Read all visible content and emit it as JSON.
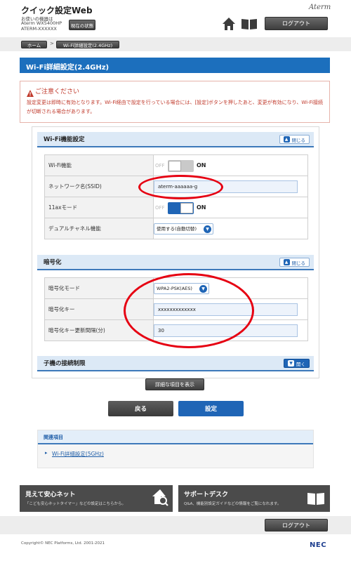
{
  "header": {
    "title": "クイック設定Web",
    "device_label": "お使いの機器は",
    "device_model": "Aterm WX5400HP",
    "device_ssid": "ATERM-XXXXXX",
    "status_button": "現在の状態",
    "logo": "Aterm",
    "logout_button": "ログアウト"
  },
  "breadcrumb": {
    "home": "ホーム",
    "separator": ">",
    "current": "Wi-Fi詳細設定(2.4GHz)"
  },
  "page_title": "Wi-Fi詳細設定(2.4GHz)",
  "notice": {
    "heading": "ご注意ください",
    "text": "設定変更は即時に有効となります。Wi-Fi経由で設定を行っている場合には、[設定]ボタンを押したあと、変更が有効になり、Wi-Fi接続が切断される場合があります。"
  },
  "wifi_section": {
    "title": "Wi-Fi機能設定",
    "toggle": "閉じる",
    "rows": {
      "wifi_label": "Wi-Fi機能",
      "wifi_off": "OFF",
      "wifi_on": "ON",
      "ssid_label": "ネットワーク名(SSID)",
      "ssid_value": "aterm-aaaaaa-g",
      "ax_label": "11axモード",
      "ax_off": "OFF",
      "ax_on": "ON",
      "dual_label": "デュアルチャネル機能",
      "dual_value": "使用する(自動切替)"
    }
  },
  "enc_section": {
    "title": "暗号化",
    "toggle": "閉じる",
    "rows": {
      "mode_label": "暗号化モード",
      "mode_value": "WPA2-PSK(AES)",
      "key_label": "暗号化キー",
      "key_value": "xxxxxxxxxxxxx",
      "interval_label": "暗号化キー更新間隔(分)",
      "interval_value": "30"
    }
  },
  "child_section": {
    "title": "子機の接続制限",
    "toggle": "開く"
  },
  "show_details_button": "詳細な項目を表示",
  "back_button": "戻る",
  "submit_button": "設定",
  "related": {
    "title": "関連項目",
    "link": "Wi-Fi詳細設定(5GHz)"
  },
  "banners": {
    "left_title": "見えて安心ネット",
    "left_sub": "「こども安心ネットタイマー」などの設定はこちらから。",
    "right_title": "サポートデスク",
    "right_sub": "Q&A、機能別設定ガイドなどの情報をご覧になれます。"
  },
  "footer": {
    "logout_button": "ログアウト",
    "copyright": "Copyright© NEC Platforms, Ltd. 2001-2021",
    "brand": "NEC"
  },
  "colors": {
    "accent": "#1f65b6",
    "title_bar": "#1c6fbd",
    "alert": "#c0392b",
    "annotation": "#e60012"
  }
}
